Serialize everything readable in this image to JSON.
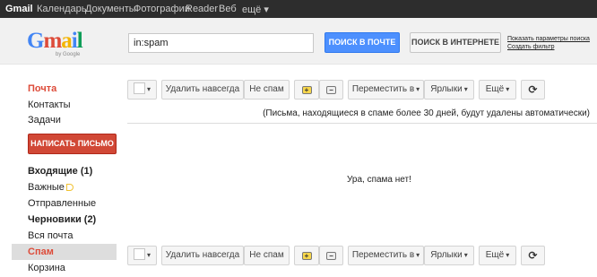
{
  "topnav": {
    "items": [
      "Gmail",
      "Календарь",
      "Документы",
      "Фотографии",
      "Reader",
      "Веб",
      "ещё ▾"
    ]
  },
  "header": {
    "logo_text": "Gmail",
    "logo_by": "by Google",
    "search_value": "in:spam",
    "search_mail_label": "ПОИСК В ПОЧТЕ",
    "search_web_label": "ПОИСК В ИНТЕРНЕТЕ",
    "show_search_options": "Показать параметры поиска",
    "create_filter": "Создать фильтр"
  },
  "sidebar": {
    "mail": "Почта",
    "contacts": "Контакты",
    "tasks": "Задачи",
    "compose": "НАПИСАТЬ ПИСЬМО",
    "folders": [
      {
        "label": "Входящие (1)"
      },
      {
        "label": "Важные"
      },
      {
        "label": "Отправленные"
      },
      {
        "label": "Черновики (2)"
      },
      {
        "label": "Вся почта"
      },
      {
        "label": "Спам"
      },
      {
        "label": "Корзина"
      }
    ]
  },
  "toolbar": {
    "delete_forever": "Удалить навсегда",
    "not_spam": "Не спам",
    "move_to": "Переместить в",
    "labels": "Ярлыки",
    "more": "Ещё",
    "caret": "▾",
    "refresh": "⟳"
  },
  "main": {
    "spam_note": "(Письма, находящиеся в спаме более 30 дней, будут удалены автоматически)",
    "empty_message": "Ура, спама нет!"
  },
  "colors": {
    "accent_red": "#dd4b39",
    "compose_bg": "#d14836",
    "search_blue": "#4d90fe",
    "topbar_bg": "#2d2d2d"
  }
}
